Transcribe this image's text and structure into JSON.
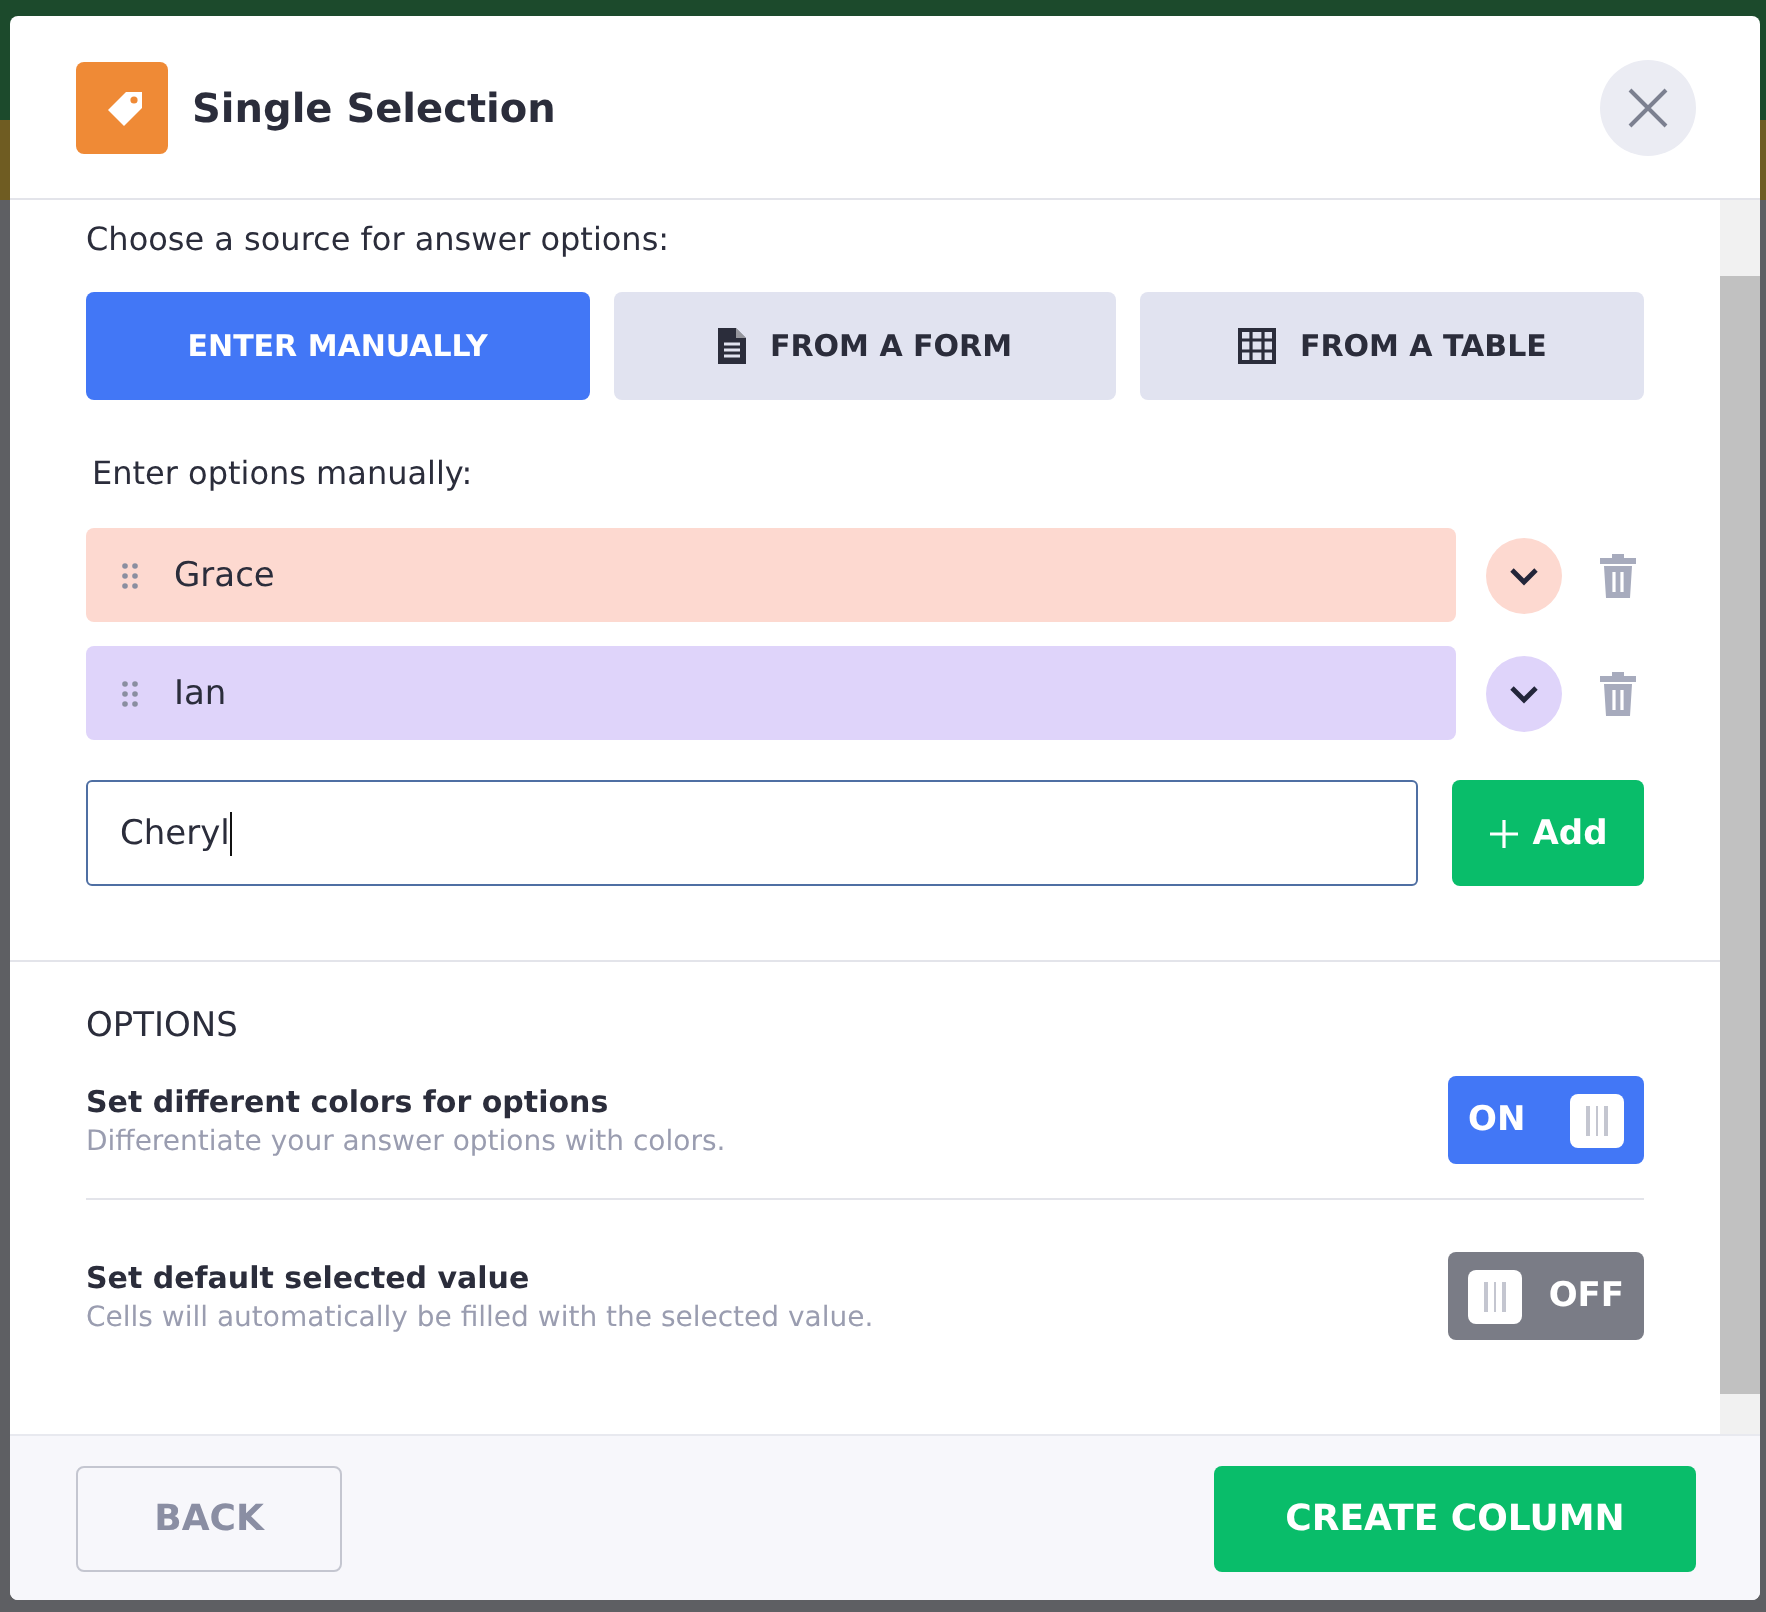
{
  "dialog": {
    "title": "Single Selection"
  },
  "source": {
    "label": "Choose a source for answer options:",
    "buttons": [
      {
        "label": "ENTER MANUALLY",
        "kind": "manual",
        "selected": true
      },
      {
        "label": "FROM A FORM",
        "kind": "form",
        "selected": false
      },
      {
        "label": "FROM A TABLE",
        "kind": "table",
        "selected": false
      }
    ]
  },
  "manual": {
    "label": "Enter options manually:",
    "options": [
      {
        "text": "Grace",
        "color": "#fdd9d0"
      },
      {
        "text": "Ian",
        "color": "#dfd4fa"
      }
    ],
    "input": {
      "value": "Cheryl"
    },
    "add_button": "Add"
  },
  "options": {
    "heading": "OPTIONS",
    "settings": [
      {
        "title": "Set different colors for options",
        "description": "Differentiate your answer options with colors.",
        "on": true,
        "label": "ON"
      },
      {
        "title": "Set default selected value",
        "description": "Cells will automatically be filled with the selected value.",
        "on": false,
        "label": "OFF"
      }
    ]
  },
  "footer": {
    "back": "BACK",
    "create": "CREATE COLUMN"
  }
}
